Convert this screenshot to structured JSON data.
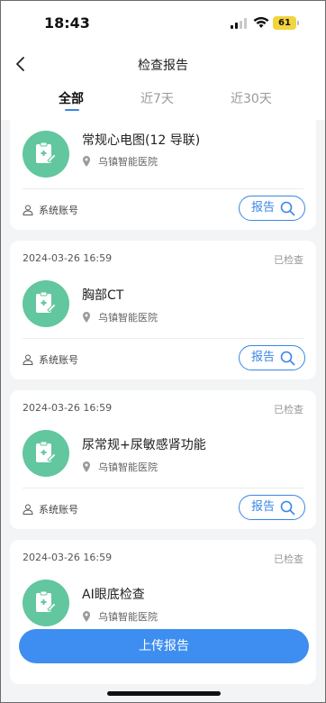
{
  "status_bar": {
    "time": "18:43",
    "battery": "61",
    "icons": [
      "cellular-signal-icon",
      "wifi-icon",
      "battery-icon"
    ]
  },
  "nav": {
    "title": "检查报告",
    "back_icon": "chevron-left-icon"
  },
  "tabs": [
    {
      "label": "全部",
      "active": true
    },
    {
      "label": "近7天",
      "active": false
    },
    {
      "label": "近30天",
      "active": false
    }
  ],
  "records": [
    {
      "date": "",
      "status": "",
      "name": "常规心电图(12 导联)",
      "hospital": "乌镇智能医院",
      "account": "系统账号",
      "button": "报告"
    },
    {
      "date": "2024-03-26 16:59",
      "status": "已检查",
      "name": "胸部CT",
      "hospital": "乌镇智能医院",
      "account": "系统账号",
      "button": "报告"
    },
    {
      "date": "2024-03-26 16:59",
      "status": "已检查",
      "name": "尿常规+尿敏感肾功能",
      "hospital": "乌镇智能医院",
      "account": "系统账号",
      "button": "报告"
    },
    {
      "date": "2024-03-26 16:59",
      "status": "已检查",
      "name": "AI眼底检查",
      "hospital": "乌镇智能医院",
      "account": "",
      "button": ""
    }
  ],
  "upload_button": "上传报告",
  "colors": {
    "accent": "#3a86e6",
    "avatar": "#62c69e",
    "background": "#f3f4f6",
    "battery": "#f2d43d"
  }
}
